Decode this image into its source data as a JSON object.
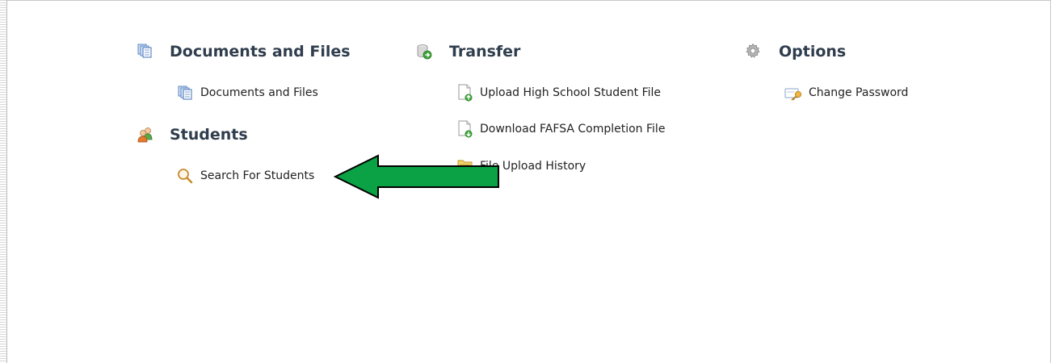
{
  "sections": {
    "documents": {
      "title": "Documents and Files",
      "links": [
        {
          "label": "Documents and Files"
        }
      ]
    },
    "students": {
      "title": "Students",
      "links": [
        {
          "label": "Search For Students"
        }
      ]
    },
    "transfer": {
      "title": "Transfer",
      "links": [
        {
          "label": "Upload High School Student File"
        },
        {
          "label": "Download FAFSA Completion File"
        },
        {
          "label": "File Upload History"
        }
      ]
    },
    "options": {
      "title": "Options",
      "links": [
        {
          "label": "Change Password"
        }
      ]
    }
  },
  "annotation": {
    "arrow_color": "#0aa245",
    "arrow_outline": "#000000",
    "points_to": "Search For Students"
  }
}
